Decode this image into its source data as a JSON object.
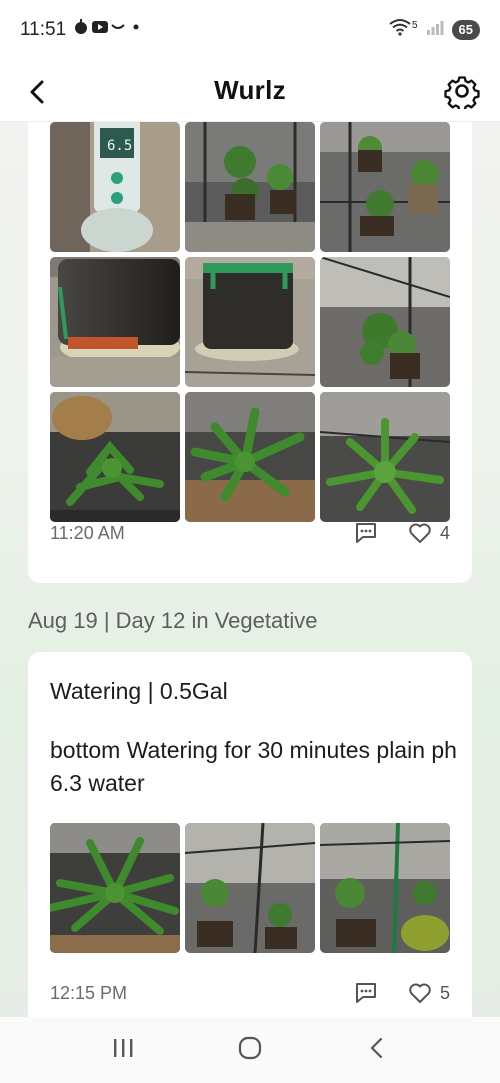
{
  "status_bar": {
    "time": "11:51",
    "network_label": "5",
    "battery": "65"
  },
  "header": {
    "title": "Wurlz"
  },
  "feed": {
    "entries": [
      {
        "time": "11:20 AM",
        "likes": "4"
      },
      {
        "day_header": "Aug 19 | Day 12 in Vegetative",
        "title": "Watering | 0.5Gal",
        "body": "bottom Watering for 30 minutes plain ph 6.3 water",
        "time": "12:15 PM",
        "likes": "5"
      }
    ]
  },
  "icons": {
    "back": "back-arrow-icon",
    "settings": "gear-icon",
    "comment": "comment-icon",
    "like": "heart-icon"
  },
  "colors": {
    "accent_green": "#2e9b5a"
  }
}
